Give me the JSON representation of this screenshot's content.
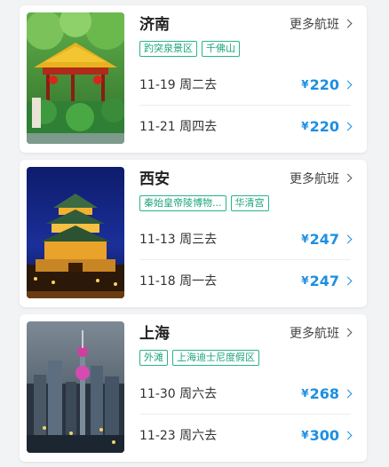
{
  "cards": [
    {
      "city": "济南",
      "more_label": "更多航班",
      "tags": [
        "趵突泉景区",
        "千佛山"
      ],
      "image_icon": "pavilion-photo",
      "flights": [
        {
          "date": "11-19 周二去",
          "currency": "¥",
          "price": "220"
        },
        {
          "date": "11-21 周四去",
          "currency": "¥",
          "price": "220"
        }
      ]
    },
    {
      "city": "西安",
      "more_label": "更多航班",
      "tags": [
        "秦始皇帝陵博物...",
        "华清宫"
      ],
      "image_icon": "bell-tower-photo",
      "flights": [
        {
          "date": "11-13 周三去",
          "currency": "¥",
          "price": "247"
        },
        {
          "date": "11-18 周一去",
          "currency": "¥",
          "price": "247"
        }
      ]
    },
    {
      "city": "上海",
      "more_label": "更多航班",
      "tags": [
        "外滩",
        "上海迪士尼度假区"
      ],
      "image_icon": "skyline-photo",
      "flights": [
        {
          "date": "11-30 周六去",
          "currency": "¥",
          "price": "268"
        },
        {
          "date": "11-23 周六去",
          "currency": "¥",
          "price": "300"
        }
      ]
    }
  ],
  "colors": {
    "accent": "#1d8fe1",
    "tag": "#1ea57d",
    "background": "#f2f3f5"
  }
}
